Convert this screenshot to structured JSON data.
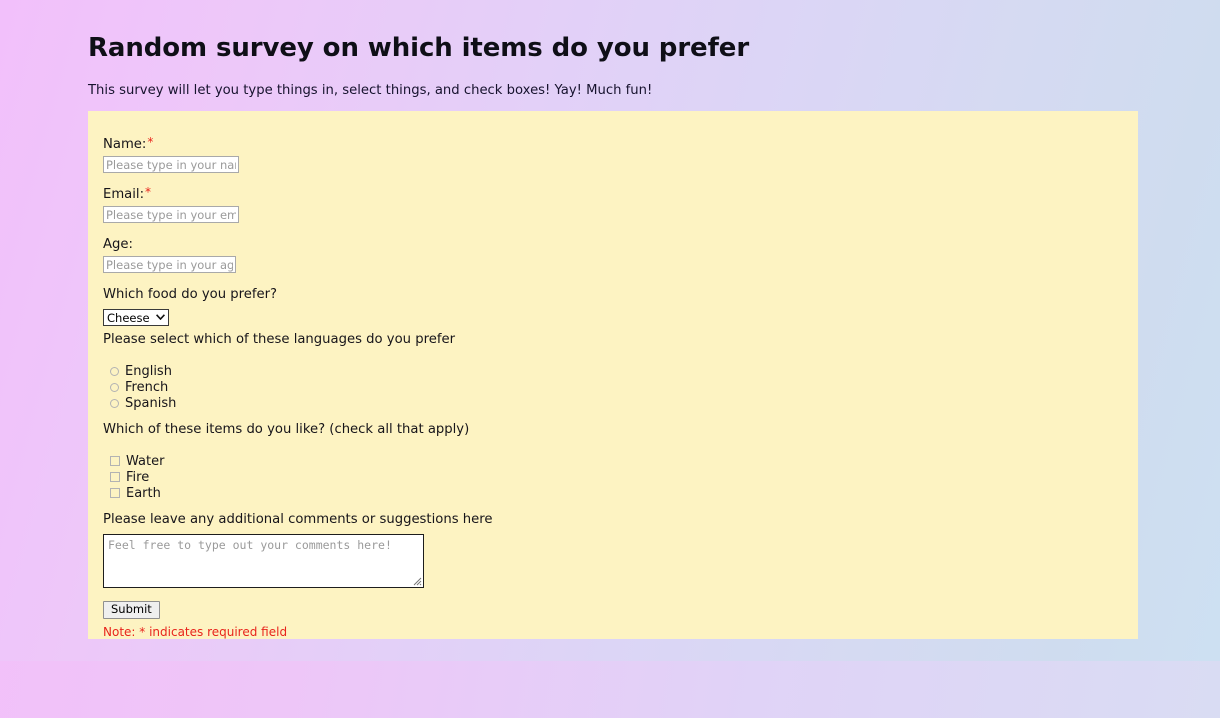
{
  "page": {
    "title": "Random survey on which items do you prefer",
    "subtitle": "This survey will let you type things in, select things, and check boxes! Yay! Much fun!",
    "panel_color": "#fdf3c2",
    "accent_required_color": "#e8241c",
    "background_gradient_from": "#f2c0fb",
    "background_gradient_to": "#cde0f2"
  },
  "form": {
    "name": {
      "label": "Name:",
      "required_marker": "*",
      "placeholder": "Please type in your name",
      "value": ""
    },
    "email": {
      "label": "Email:",
      "required_marker": "*",
      "placeholder": "Please type in your email",
      "value": ""
    },
    "age": {
      "label": "Age:",
      "placeholder": "Please type in your age",
      "value": ""
    },
    "food": {
      "label": "Which food do you prefer?",
      "selected": "Cheese",
      "options": [
        "Cheese"
      ],
      "chevron_icon": "chevron-down-icon"
    },
    "languages": {
      "label": "Please select which of these languages do you prefer",
      "options": [
        {
          "label": "English",
          "checked": false
        },
        {
          "label": "French",
          "checked": false
        },
        {
          "label": "Spanish",
          "checked": false
        }
      ]
    },
    "items": {
      "label": "Which of these items do you like? (check all that apply)",
      "options": [
        {
          "label": "Water",
          "checked": false
        },
        {
          "label": "Fire",
          "checked": false
        },
        {
          "label": "Earth",
          "checked": false
        }
      ]
    },
    "comments": {
      "label": "Please leave any additional comments or suggestions here",
      "placeholder": "Feel free to type out your comments here!",
      "value": "",
      "resize_grip_icon": "resize-grip-icon"
    },
    "submit": {
      "label": "Submit"
    },
    "note": {
      "text": "Note: * indicates required field"
    }
  }
}
